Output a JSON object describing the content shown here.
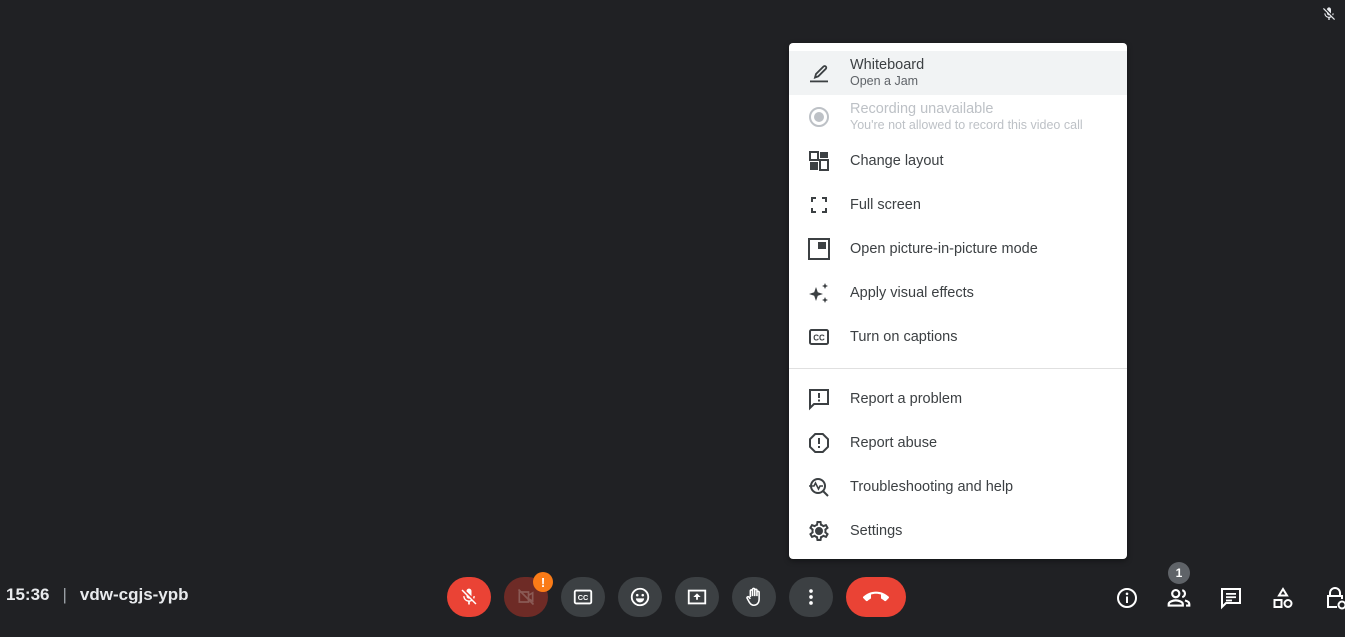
{
  "status": {
    "self_muted_icon": "mic-off-icon"
  },
  "menu": {
    "items": [
      {
        "label": "Whiteboard",
        "sub": "Open a Jam",
        "icon": "pencil-icon",
        "highlighted": true
      },
      {
        "label": "Recording unavailable",
        "sub": "You're not allowed to record this video call",
        "icon": "record-icon",
        "disabled": true
      },
      {
        "label": "Change layout",
        "icon": "layout-icon"
      },
      {
        "label": "Full screen",
        "icon": "fullscreen-icon"
      },
      {
        "label": "Open picture-in-picture mode",
        "icon": "pip-icon"
      },
      {
        "label": "Apply visual effects",
        "icon": "sparkle-icon"
      },
      {
        "label": "Turn on captions",
        "icon": "captions-icon"
      }
    ],
    "items_secondary": [
      {
        "label": "Report a problem",
        "icon": "feedback-icon"
      },
      {
        "label": "Report abuse",
        "icon": "report-icon"
      },
      {
        "label": "Troubleshooting and help",
        "icon": "troubleshoot-icon"
      },
      {
        "label": "Settings",
        "icon": "settings-icon"
      }
    ]
  },
  "meeting": {
    "time": "15:36",
    "separator": "|",
    "code": "vdw-cgjs-ypb"
  },
  "controls": {
    "camera_badge": "!",
    "people_count": "1"
  },
  "colors": {
    "background": "#202124",
    "danger": "#ea4335",
    "warning": "#fa7b17",
    "control_bg": "#3c4043"
  }
}
